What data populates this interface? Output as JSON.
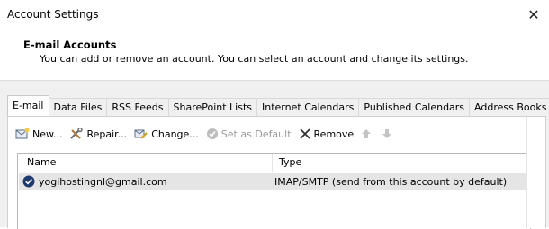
{
  "window": {
    "title": "Account Settings",
    "close_glyph": "✕"
  },
  "header": {
    "title": "E-mail Accounts",
    "description": "You can add or remove an account. You can select an account and change its settings."
  },
  "tabs": [
    {
      "label": "E-mail",
      "active": true
    },
    {
      "label": "Data Files"
    },
    {
      "label": "RSS Feeds"
    },
    {
      "label": "SharePoint Lists"
    },
    {
      "label": "Internet Calendars"
    },
    {
      "label": "Published Calendars"
    },
    {
      "label": "Address Books"
    }
  ],
  "toolbar": {
    "new_label": "New...",
    "repair_label": "Repair...",
    "change_label": "Change...",
    "set_default_label": "Set as Default",
    "remove_label": "Remove"
  },
  "table": {
    "columns": [
      "Name",
      "Type"
    ],
    "rows": [
      {
        "name": "yogihostingnl@gmail.com",
        "type": "IMAP/SMTP (send from this account by default)"
      }
    ]
  },
  "colors": {
    "accent": "#1e3a6e",
    "selection": "#e5e5e5",
    "frame": "#f0f0f0"
  }
}
